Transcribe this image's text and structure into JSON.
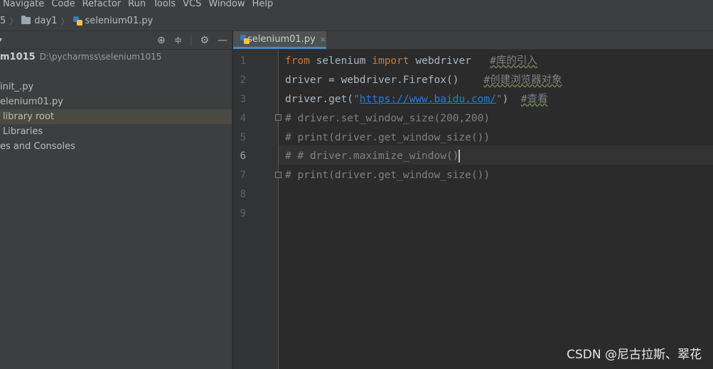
{
  "menu": {
    "items": [
      "Navigate",
      "Code",
      "Refactor",
      "Run",
      "Tools",
      "VCS",
      "Window",
      "Help"
    ]
  },
  "breadcrumb": {
    "project": "5",
    "folder": "day1",
    "file": "selenium01.py"
  },
  "project_panel": {
    "toolbar_icons": [
      "target-icon",
      "collapse-icon",
      "gear-icon",
      "minimize-icon"
    ],
    "tree": [
      {
        "label": "m1015",
        "path": "D:\\pycharmss\\selenium1015"
      },
      {
        "label": ""
      },
      {
        "label": "init_.py"
      },
      {
        "label": "elenium01.py"
      },
      {
        "label": "library root"
      },
      {
        "label": "Libraries"
      },
      {
        "label": "es and Consoles"
      }
    ]
  },
  "editor": {
    "tab_label": "selenium01.py",
    "tab_close": "×",
    "current_line": 6,
    "line_numbers": [
      "1",
      "2",
      "3",
      "4",
      "5",
      "6",
      "7",
      "8",
      "9"
    ],
    "lines": {
      "l1_kw1": "from",
      "l1_mod": " selenium ",
      "l1_kw2": "import",
      "l1_name": " webdriver   ",
      "l1_cmt": "#库的引入",
      "l2_code": "driver = webdriver.Firefox()    ",
      "l2_cmt": "#创建浏览器对象",
      "l3_code": "driver.get(",
      "l3_q1": "\"",
      "l3_url": "https://www.baidu.com/",
      "l3_q2": "\"",
      "l3_close": ")  ",
      "l3_cmt": "#查看",
      "l4": "# driver.set_window_size(200,200)",
      "l5": "# print(driver.get_window_size())",
      "l6": "# # driver.maximize_window()",
      "l7": "# print(driver.get_window_size())"
    }
  },
  "watermark": "CSDN @尼古拉斯、翠花",
  "colors": {
    "keyword": "#cc7832",
    "string": "#6a8759",
    "comment": "#808080",
    "link": "#287bde",
    "tab_underline": "#4a88c7"
  }
}
